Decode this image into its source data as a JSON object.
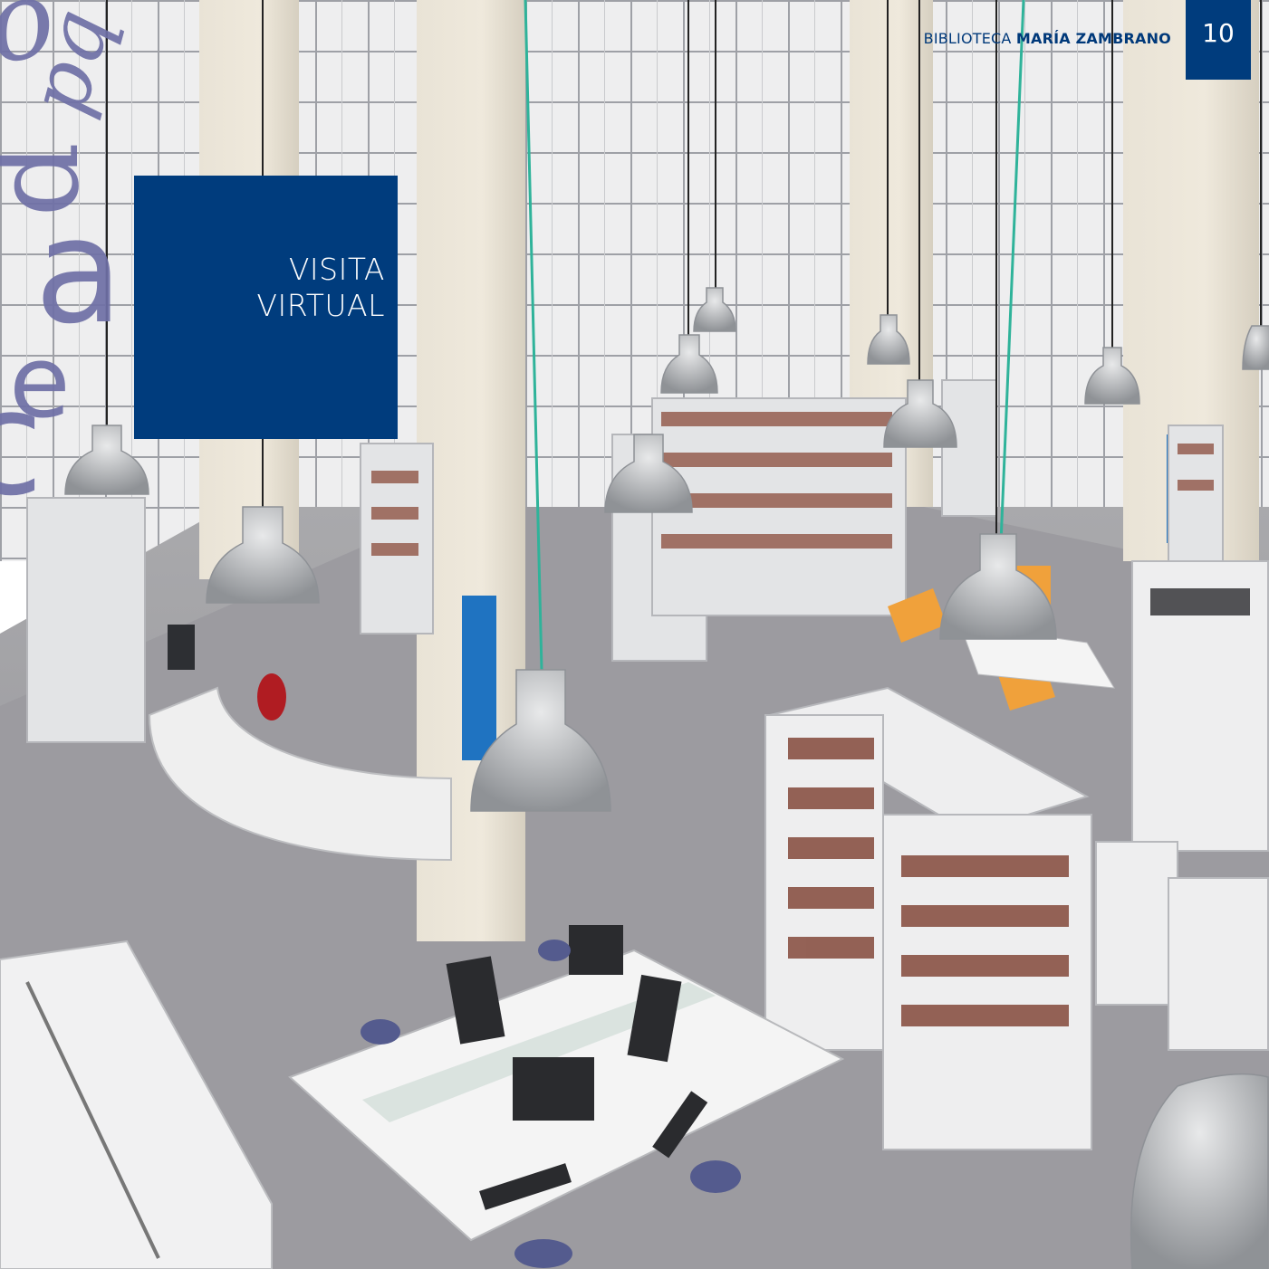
{
  "header": {
    "prefix": "BIBLIOTECA",
    "name": "MARÍA ZAMBRANO",
    "page_number": "10"
  },
  "title_box": {
    "line1": "VISITA",
    "line2": "VIRTUAL"
  },
  "colors": {
    "brand_blue": "#003c7d",
    "decor_letters": "#6f70a6"
  }
}
